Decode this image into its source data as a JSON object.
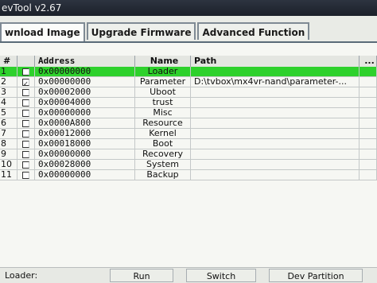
{
  "window": {
    "title": "evTool v2.67"
  },
  "tabs": [
    {
      "label": "wnload Image"
    },
    {
      "label": "Upgrade Firmware"
    },
    {
      "label": "Advanced Function"
    }
  ],
  "table": {
    "headers": {
      "num": "#",
      "check": "",
      "address": "Address",
      "name": "Name",
      "path": "Path",
      "more": "..."
    },
    "rows": [
      {
        "num": "1",
        "checked": false,
        "address": "0x00000000",
        "name": "Loader",
        "path": "",
        "selected": true
      },
      {
        "num": "2",
        "checked": true,
        "address": "0x00000000",
        "name": "Parameter",
        "path": "D:\\tvbox\\mx4vr-nand\\parameter-..."
      },
      {
        "num": "3",
        "checked": false,
        "address": "0x00002000",
        "name": "Uboot",
        "path": ""
      },
      {
        "num": "4",
        "checked": false,
        "address": "0x00004000",
        "name": "trust",
        "path": ""
      },
      {
        "num": "5",
        "checked": false,
        "address": "0x00000000",
        "name": "Misc",
        "path": ""
      },
      {
        "num": "6",
        "checked": false,
        "address": "0x0000A800",
        "name": "Resource",
        "path": ""
      },
      {
        "num": "7",
        "checked": false,
        "address": "0x00012000",
        "name": "Kernel",
        "path": ""
      },
      {
        "num": "8",
        "checked": false,
        "address": "0x00018000",
        "name": "Boot",
        "path": ""
      },
      {
        "num": "9",
        "checked": false,
        "address": "0x00000000",
        "name": "Recovery",
        "path": ""
      },
      {
        "num": "10",
        "checked": false,
        "address": "0x00028000",
        "name": "System",
        "path": ""
      },
      {
        "num": "11",
        "checked": false,
        "address": "0x00000000",
        "name": "Backup",
        "path": ""
      }
    ]
  },
  "bottom": {
    "loader_label": "Loader:",
    "run": "Run",
    "switch": "Switch",
    "dev_partition": "Dev Partition"
  },
  "colors": {
    "selected_row": "#2ed12c",
    "titlebar": "#1b2029"
  }
}
